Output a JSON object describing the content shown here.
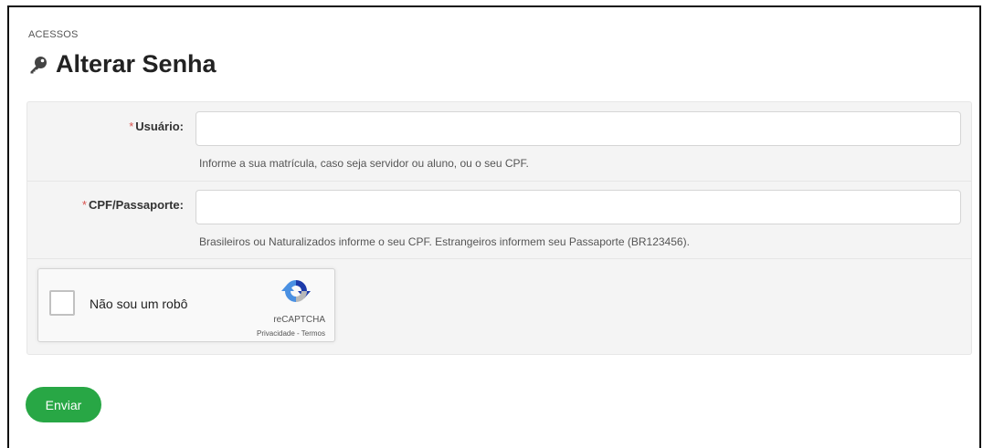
{
  "breadcrumb": "ACESSOS",
  "page": {
    "title": "Alterar Senha",
    "title_icon": "key-icon"
  },
  "form": {
    "required_marker": "*",
    "usuario": {
      "label": "Usuário:",
      "value": "",
      "placeholder": "",
      "help": "Informe a sua matrícula, caso seja servidor ou aluno, ou o seu CPF."
    },
    "cpf": {
      "label": "CPF/Passaporte:",
      "value": "",
      "placeholder": "",
      "help": "Brasileiros ou Naturalizados informe o seu CPF. Estrangeiros informem seu Passaporte (BR123456)."
    },
    "captcha": {
      "label": "Não sou um robô",
      "brand": "reCAPTCHA",
      "links": "Privacidade - Termos",
      "checked": false
    },
    "submit_label": "Enviar"
  },
  "colors": {
    "accent": "#28a745",
    "required": "#d9534f"
  }
}
